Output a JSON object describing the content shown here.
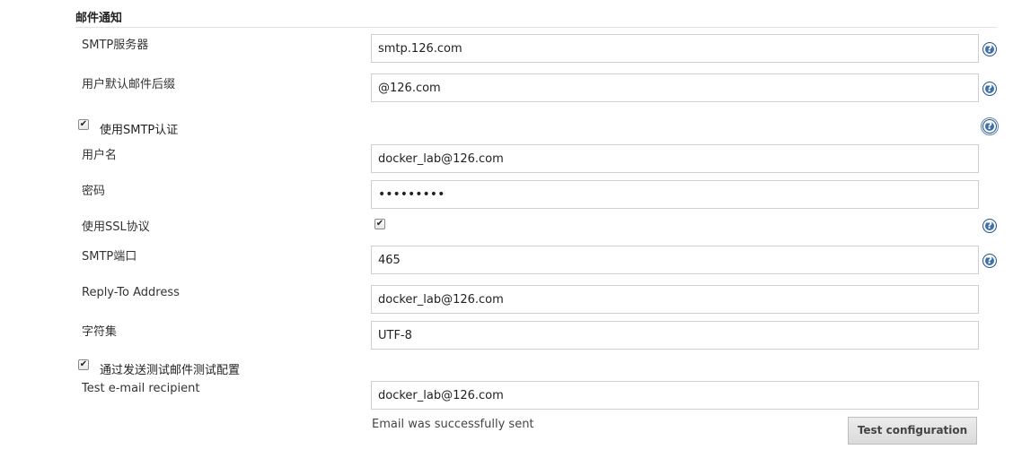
{
  "section": {
    "title": "邮件通知"
  },
  "fields": {
    "smtp_server": {
      "label": "SMTP服务器",
      "value": "smtp.126.com"
    },
    "default_suffix": {
      "label": "用户默认邮件后缀",
      "value": "@126.com"
    },
    "use_smtp_auth": {
      "label": "使用SMTP认证",
      "checked": true
    },
    "username": {
      "label": "用户名",
      "value": "docker_lab@126.com"
    },
    "password": {
      "label": "密码",
      "value": "•••••••••"
    },
    "use_ssl": {
      "label": "使用SSL协议",
      "checked": true
    },
    "smtp_port": {
      "label": "SMTP端口",
      "value": "465"
    },
    "reply_to": {
      "label": "Reply-To Address",
      "value": "docker_lab@126.com"
    },
    "charset": {
      "label": "字符集",
      "value": "UTF-8"
    },
    "test_by_sending": {
      "label": "通过发送测试邮件测试配置",
      "checked": true
    },
    "test_recipient": {
      "label": "Test e-mail recipient",
      "value": "docker_lab@126.com"
    }
  },
  "help_icon_glyph": "?",
  "check_glyph": "✔",
  "status_message": "Email was successfully sent",
  "test_button_label": "Test configuration",
  "colors": {
    "help_icon": "#3f6fa6",
    "section_rule": "#e2e2e2"
  }
}
